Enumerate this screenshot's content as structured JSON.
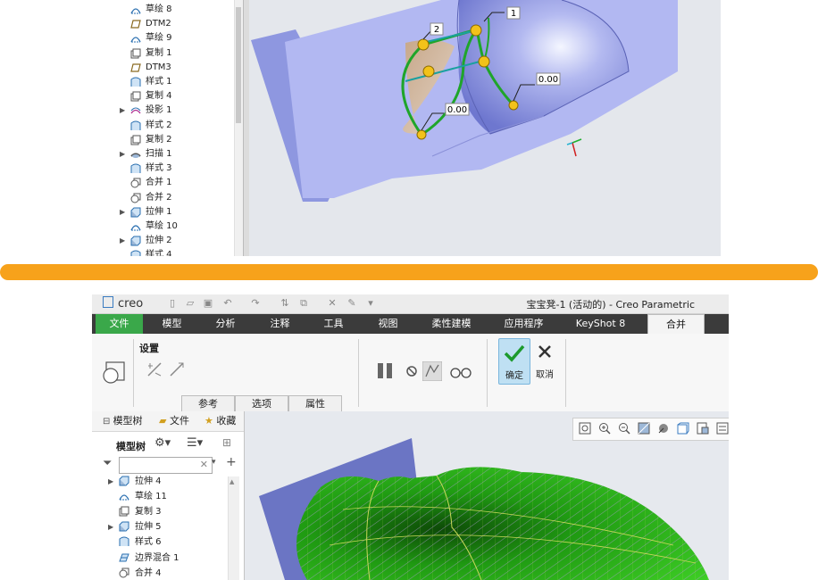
{
  "top_screenshot": {
    "tree_items": [
      {
        "label": "草绘 8",
        "icon": "sketch-icon",
        "expand": false
      },
      {
        "label": "DTM2",
        "icon": "datum-plane-icon",
        "expand": false
      },
      {
        "label": "草绘 9",
        "icon": "sketch-icon",
        "expand": false
      },
      {
        "label": "复制 1",
        "icon": "copy-icon",
        "expand": false
      },
      {
        "label": "DTM3",
        "icon": "datum-plane-icon",
        "expand": false
      },
      {
        "label": "样式 1",
        "icon": "style-icon",
        "expand": false
      },
      {
        "label": "复制 4",
        "icon": "copy-icon",
        "expand": false
      },
      {
        "label": "投影 1",
        "icon": "projection-icon",
        "expand": true
      },
      {
        "label": "样式 2",
        "icon": "style-icon",
        "expand": false
      },
      {
        "label": "复制 2",
        "icon": "copy-icon",
        "expand": false
      },
      {
        "label": "扫描 1",
        "icon": "sweep-icon",
        "expand": true
      },
      {
        "label": "样式 3",
        "icon": "style-icon",
        "expand": false
      },
      {
        "label": "合并 1",
        "icon": "merge-icon",
        "expand": false
      },
      {
        "label": "合并 2",
        "icon": "merge-icon",
        "expand": false
      },
      {
        "label": "拉伸 1",
        "icon": "extrude-icon",
        "expand": true
      },
      {
        "label": "草绘 10",
        "icon": "sketch-icon",
        "expand": false
      },
      {
        "label": "拉伸 2",
        "icon": "extrude-icon",
        "expand": true
      },
      {
        "label": "样式 4",
        "icon": "style-icon",
        "expand": false
      }
    ],
    "annotations": {
      "label_1": "1",
      "label_2": "2",
      "value_a": "0.00",
      "value_b": "0.00"
    }
  },
  "divider_color": "#f7a21b",
  "bottom_screenshot": {
    "app_logo": "creo",
    "window_title": "宝宝凳-1 (活动的) - Creo Parametric",
    "tabs": [
      {
        "label": "文件"
      },
      {
        "label": "模型"
      },
      {
        "label": "分析"
      },
      {
        "label": "注释"
      },
      {
        "label": "工具"
      },
      {
        "label": "视图"
      },
      {
        "label": "柔性建模"
      },
      {
        "label": "应用程序"
      },
      {
        "label": "KeyShot 8"
      },
      {
        "label": "合并"
      }
    ],
    "ribbon": {
      "settings_label": "设置",
      "subtabs": [
        "参考",
        "选项",
        "属性"
      ],
      "ok_label": "确定",
      "cancel_label": "取消"
    },
    "panel": {
      "tabs": [
        "模型树",
        "文件",
        "收藏"
      ],
      "model_tree_label": "模型树",
      "filter_value": "",
      "tree_items": [
        {
          "label": "拉伸 4",
          "icon": "extrude-icon",
          "expand": true
        },
        {
          "label": "草绘 11",
          "icon": "sketch-icon",
          "expand": false
        },
        {
          "label": "复制 3",
          "icon": "copy-icon",
          "expand": false
        },
        {
          "label": "拉伸 5",
          "icon": "extrude-icon",
          "expand": true
        },
        {
          "label": "样式 6",
          "icon": "style-icon",
          "expand": false
        },
        {
          "label": "边界混合 1",
          "icon": "boundary-blend-icon",
          "expand": false
        },
        {
          "label": "合并 4",
          "icon": "merge-icon",
          "expand": false
        }
      ]
    },
    "colors": {
      "file_tab": "#3aa84a",
      "tabbar": "#3b3b3b",
      "model_green": "#2fc21a",
      "plane_blue": "#6b75c4"
    }
  }
}
